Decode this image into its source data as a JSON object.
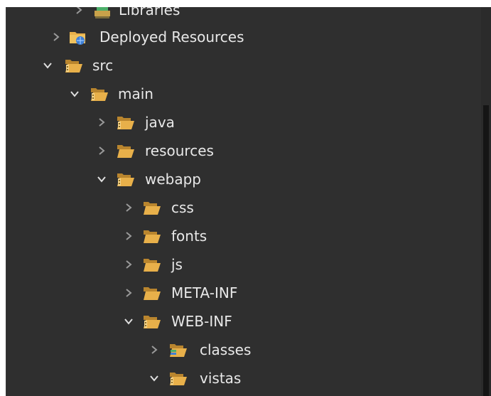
{
  "colors": {
    "background": "#2f2f2f",
    "text": "#e8e8e8",
    "chevron": "#9a9a9a",
    "folder": "#e8b04a",
    "folder_dark": "#b9852e",
    "folder_light": "#f5d389"
  },
  "tree": {
    "libraries_label": "Libraries",
    "deployed_resources_label": "Deployed Resources",
    "src_label": "src",
    "main_label": "main",
    "java_label": "java",
    "resources_label": "resources",
    "webapp_label": "webapp",
    "css_label": "css",
    "fonts_label": "fonts",
    "js_label": "js",
    "meta_inf_label": "META-INF",
    "web_inf_label": "WEB-INF",
    "classes_label": "classes",
    "vistas_label": "vistas"
  }
}
